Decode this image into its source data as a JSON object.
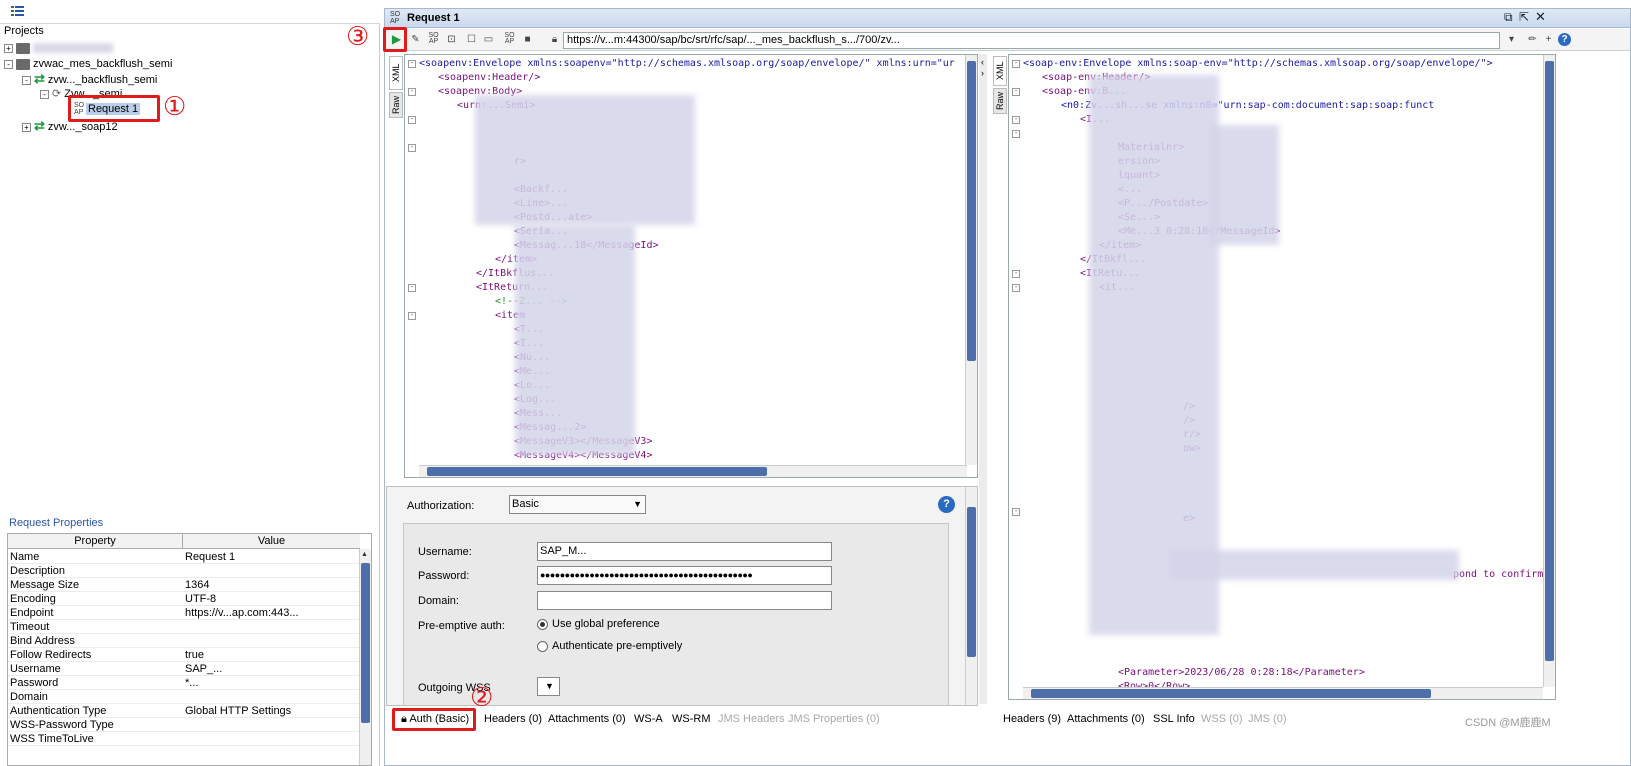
{
  "left": {
    "projects_label": "Projects",
    "tree": [
      {
        "label": "zvwac_mes_backflush_semi"
      },
      {
        "label": "zvw..._backflush_semi"
      },
      {
        "label": "Zvw..._semi"
      },
      {
        "label": "Request 1"
      },
      {
        "label": "zvw..._soap12"
      }
    ],
    "request_properties_title": "Request Properties",
    "props_headers": [
      "Property",
      "Value"
    ],
    "props": [
      {
        "k": "Name",
        "v": "Request 1"
      },
      {
        "k": "Description",
        "v": ""
      },
      {
        "k": "Message Size",
        "v": "1364"
      },
      {
        "k": "Encoding",
        "v": "UTF-8"
      },
      {
        "k": "Endpoint",
        "v": "https://v...ap.com:443..."
      },
      {
        "k": "Timeout",
        "v": ""
      },
      {
        "k": "Bind Address",
        "v": ""
      },
      {
        "k": "Follow Redirects",
        "v": "true"
      },
      {
        "k": "Username",
        "v": "SAP_..."
      },
      {
        "k": "Password",
        "v": "*..."
      },
      {
        "k": "Domain",
        "v": ""
      },
      {
        "k": "Authentication Type",
        "v": "Global HTTP Settings"
      },
      {
        "k": "WSS-Password Type",
        "v": ""
      },
      {
        "k": "WSS TimeToLive",
        "v": ""
      }
    ]
  },
  "window": {
    "title": "Request 1",
    "url": "https://v...m:44300/sap/bc/srt/rfc/sap/..._mes_backflush_s.../700/zv..."
  },
  "request_xml": [
    {
      "i": 0,
      "t": "<soapenv:Envelope xmlns:soapenv=\"http://schemas.xmlsoap.org/soap/envelope/\" xmlns:urn=\"ur"
    },
    {
      "i": 1,
      "t": "<soapenv:Header/>"
    },
    {
      "i": 1,
      "t": "<soapenv:Body>"
    },
    {
      "i": 2,
      "t": "<urn:...Semi>"
    },
    {
      "i": 3,
      "t": ""
    },
    {
      "i": 3,
      "t": ""
    },
    {
      "i": 4,
      "t": ""
    },
    {
      "i": 5,
      "t": "r>"
    },
    {
      "i": 5,
      "t": ""
    },
    {
      "i": 5,
      "t": "<Backf..."
    },
    {
      "i": 5,
      "t": "<Line>..."
    },
    {
      "i": 5,
      "t": "<Postd...ate>"
    },
    {
      "i": 5,
      "t": "<Seria..."
    },
    {
      "i": 5,
      "t": "<Messag...18</MessageId>"
    },
    {
      "i": 4,
      "t": "</item>"
    },
    {
      "i": 3,
      "t": "</ItBkflus..."
    },
    {
      "i": 3,
      "t": "<ItReturn..."
    },
    {
      "i": 4,
      "t": "<!--Z... -->"
    },
    {
      "i": 4,
      "t": "<item"
    },
    {
      "i": 5,
      "t": "<T..."
    },
    {
      "i": 5,
      "t": "<I..."
    },
    {
      "i": 5,
      "t": "<Nu..."
    },
    {
      "i": 5,
      "t": "<Me..."
    },
    {
      "i": 5,
      "t": "<Lo..."
    },
    {
      "i": 5,
      "t": "<Log..."
    },
    {
      "i": 5,
      "t": "<Mess..."
    },
    {
      "i": 5,
      "t": "<Messag...2>"
    },
    {
      "i": 5,
      "t": "<MessageV3></MessageV3>"
    },
    {
      "i": 5,
      "t": "<MessageV4></MessageV4>"
    }
  ],
  "response_xml": [
    {
      "i": 0,
      "t": "<soap-env:Envelope xmlns:soap-env=\"http://schemas.xmlsoap.org/soap/envelope/\">"
    },
    {
      "i": 1,
      "t": "<soap-env:Header/>"
    },
    {
      "i": 1,
      "t": "<soap-env:B..."
    },
    {
      "i": 2,
      "t": "<n0:Zv...sh...se xmlns:n0=\"urn:sap-com:document:sap:soap:funct"
    },
    {
      "i": 3,
      "t": "<I..."
    },
    {
      "i": 4,
      "t": ""
    },
    {
      "i": 5,
      "t": "Materialnr>"
    },
    {
      "i": 5,
      "t": "ersion>"
    },
    {
      "i": 5,
      "t": "lquant>"
    },
    {
      "i": 5,
      "t": "<..."
    },
    {
      "i": 5,
      "t": "<P.../Postdate>"
    },
    {
      "i": 5,
      "t": "<Se...>"
    },
    {
      "i": 5,
      "t": "<Me...3 0:28:18</MessageId>"
    },
    {
      "i": 4,
      "t": "</item>"
    },
    {
      "i": 3,
      "t": "</ItBkfl..."
    },
    {
      "i": 3,
      "t": "<ItRetu..."
    },
    {
      "i": 4,
      "t": "<it..."
    }
  ],
  "response_tail": [
    {
      "t": "/>"
    },
    {
      "t": "/>"
    },
    {
      "t": "r/>"
    },
    {
      "t": "ow>"
    },
    {
      "t": "e>"
    },
    {
      "t": "pond to confirm"
    },
    {
      "t": "<Parameter>2023/06/28 0:28:18</Parameter>"
    },
    {
      "t": "<Row>0</Row>"
    }
  ],
  "auth": {
    "authorization_label": "Authorization:",
    "authorization_value": "Basic",
    "username_label": "Username:",
    "username_value": "SAP_M...",
    "password_label": "Password:",
    "password_value": "●●●●●●●●●●●●●●●●●●●●●●●●●●●●●●●●●●●●●●●●●●●",
    "domain_label": "Domain:",
    "preemptive_label": "Pre-emptive auth:",
    "radio1": "Use global preference",
    "radio2": "Authenticate pre-emptively",
    "outgoing_wss_label": "Outgoing WSS"
  },
  "request_tabs": [
    "Auth (Basic)",
    "Headers (0)",
    "Attachments (0)",
    "WS-A",
    "WS-RM",
    "JMS Headers",
    "JMS Properties (0)"
  ],
  "response_tabs": [
    "Headers (9)",
    "Attachments (0)",
    "SSL Info",
    "WSS (0)",
    "JMS (0)"
  ],
  "editor_tabs": {
    "xml": "XML",
    "raw": "Raw"
  },
  "annotations": {
    "one": "①",
    "two": "②",
    "three": "③"
  },
  "watermark": "CSDN @M鹿鹿M",
  "colors": {
    "accent": "#2a56a8",
    "annotation": "#e01b1b",
    "scroll_thumb": "#4d6ea8"
  }
}
